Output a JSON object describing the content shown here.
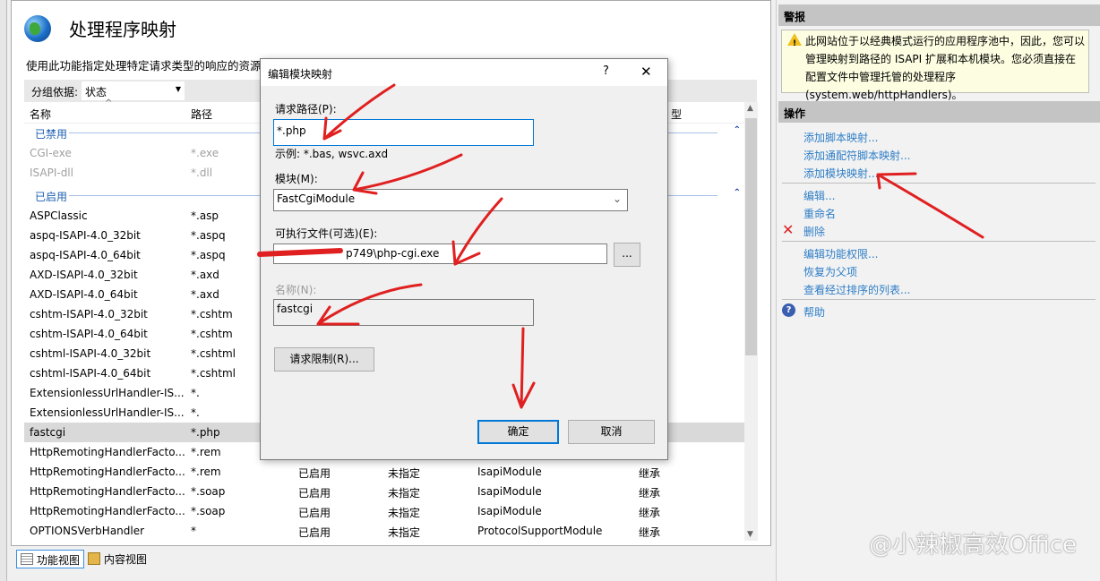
{
  "main": {
    "title": "处理程序映射",
    "description": "使用此功能指定处理特定请求类型的响应的资源。",
    "group_label": "分组依据:",
    "group_value": "状态",
    "columns": {
      "name": "名称",
      "path": "路径",
      "type_partial": "型"
    },
    "groups": {
      "disabled": "已禁用",
      "enabled": "已启用"
    },
    "disabled_rows": [
      {
        "name": "CGI-exe",
        "path": "*.exe"
      },
      {
        "name": "ISAPI-dll",
        "path": "*.dll"
      }
    ],
    "enabled_rows": [
      {
        "name": "ASPClassic",
        "path": "*.asp"
      },
      {
        "name": "aspq-ISAPI-4.0_32bit",
        "path": "*.aspq"
      },
      {
        "name": "aspq-ISAPI-4.0_64bit",
        "path": "*.aspq"
      },
      {
        "name": "AXD-ISAPI-4.0_32bit",
        "path": "*.axd"
      },
      {
        "name": "AXD-ISAPI-4.0_64bit",
        "path": "*.axd"
      },
      {
        "name": "cshtm-ISAPI-4.0_32bit",
        "path": "*.cshtm"
      },
      {
        "name": "cshtm-ISAPI-4.0_64bit",
        "path": "*.cshtm"
      },
      {
        "name": "cshtml-ISAPI-4.0_32bit",
        "path": "*.cshtml"
      },
      {
        "name": "cshtml-ISAPI-4.0_64bit",
        "path": "*.cshtml"
      },
      {
        "name": "ExtensionlessUrlHandler-IS...",
        "path": "*."
      },
      {
        "name": "ExtensionlessUrlHandler-IS...",
        "path": "*."
      },
      {
        "name": "fastcgi",
        "path": "*.php"
      },
      {
        "name": "HttpRemotingHandlerFacto...",
        "path": "*.rem"
      }
    ],
    "full_rows": [
      {
        "name": "HttpRemotingHandlerFacto...",
        "path": "*.rem",
        "state": "已启用",
        "path_type": "未指定",
        "handler": "IsapiModule",
        "entry": "继承"
      },
      {
        "name": "HttpRemotingHandlerFacto...",
        "path": "*.soap",
        "state": "已启用",
        "path_type": "未指定",
        "handler": "IsapiModule",
        "entry": "继承"
      },
      {
        "name": "HttpRemotingHandlerFacto...",
        "path": "*.soap",
        "state": "已启用",
        "path_type": "未指定",
        "handler": "IsapiModule",
        "entry": "继承"
      },
      {
        "name": "OPTIONSVerbHandler",
        "path": "*",
        "state": "已启用",
        "path_type": "未指定",
        "handler": "ProtocolSupportModule",
        "entry": "继承"
      }
    ]
  },
  "bottom_tabs": {
    "features": "功能视图",
    "content": "内容视图"
  },
  "right": {
    "alerts_header": "警报",
    "alert_text": "此网站位于以经典模式运行的应用程序池中，因此，您可以管理映射到路径的 ISAPI 扩展和本机模块。您必须直接在配置文件中管理托管的处理程序(system.web/httpHandlers)。",
    "actions_header": "操作",
    "actions": [
      "添加脚本映射...",
      "添加通配符脚本映射...",
      "添加模块映射...",
      "编辑...",
      "重命名",
      "删除",
      "编辑功能权限...",
      "恢复为父项",
      "查看经过排序的列表...",
      "帮助"
    ]
  },
  "dialog": {
    "title": "编辑模块映射",
    "help": "?",
    "close": "✕",
    "request_path_label": "请求路径(P):",
    "request_path_value": "*.php",
    "example": "示例: *.bas, wsvc.axd",
    "module_label": "模块(M):",
    "module_value": "FastCgiModule",
    "executable_label": "可执行文件(可选)(E):",
    "executable_value": "p749\\php-cgi.exe",
    "browse": "...",
    "name_label": "名称(N):",
    "name_value": "fastcgi",
    "restrictions": "请求限制(R)...",
    "ok": "确定",
    "cancel": "取消"
  },
  "watermark": "@小辣椒高效Office",
  "colors": {
    "link": "#2e7ec7",
    "annotation": "#e02020",
    "focus": "#0078d7"
  }
}
